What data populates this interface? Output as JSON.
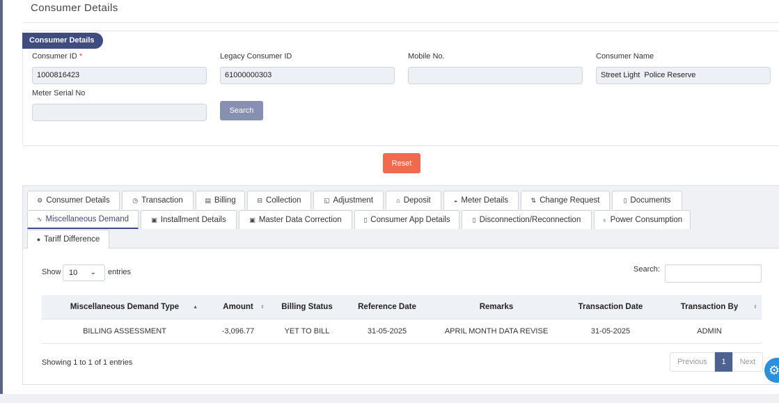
{
  "page": {
    "title": "Consumer Details"
  },
  "card": {
    "badge": "Consumer Details",
    "fields": {
      "consumer_id": {
        "label": "Consumer ID",
        "required_mark": "*",
        "value": "1000816423"
      },
      "legacy_consumer_id": {
        "label": "Legacy Consumer ID",
        "value": "61000000303"
      },
      "mobile_no": {
        "label": "Mobile No.",
        "value": ""
      },
      "consumer_name": {
        "label": "Consumer Name",
        "value": "Street Light  Police Reserve"
      },
      "meter_serial_no": {
        "label": "Meter Serial No",
        "value": ""
      }
    },
    "search_label": "Search"
  },
  "reset_label": "Reset",
  "tabs": [
    {
      "label": "Consumer Details",
      "icon": "gear-icon"
    },
    {
      "label": "Transaction",
      "icon": "clock-icon"
    },
    {
      "label": "Billing",
      "icon": "bill-icon"
    },
    {
      "label": "Collection",
      "icon": "collection-icon"
    },
    {
      "label": "Adjustment",
      "icon": "adjust-icon"
    },
    {
      "label": "Deposit",
      "icon": "bank-icon"
    },
    {
      "label": "Meter Details",
      "icon": "meter-icon"
    },
    {
      "label": "Change Request",
      "icon": "swap-icon"
    },
    {
      "label": "Documents",
      "icon": "document-icon"
    },
    {
      "label": "Miscellaneous Demand",
      "icon": "pulse-icon",
      "active": true
    },
    {
      "label": "Installment Details",
      "icon": "list-icon"
    },
    {
      "label": "Master Data Correction",
      "icon": "list-icon"
    },
    {
      "label": "Consumer App Details",
      "icon": "mobile-icon"
    },
    {
      "label": "Disconnection/Reconnection",
      "icon": "mobile-icon"
    },
    {
      "label": "Power Consumption",
      "icon": "bulb-icon"
    },
    {
      "label": "Tariff Difference",
      "icon": "dot-icon"
    }
  ],
  "table": {
    "show_label": "Show",
    "page_length": "10",
    "entries_label": "entries",
    "search_label": "Search:",
    "columns": [
      "Miscellaneous Demand Type",
      "Amount",
      "Billing Status",
      "Reference Date",
      "Remarks",
      "Transaction Date",
      "Transaction By"
    ],
    "rows": [
      [
        "BILLING ASSESSMENT",
        "-3,096.77",
        "YET TO BILL",
        "31-05-2025",
        "APRIL MONTH DATA REVISE",
        "31-05-2025",
        "ADMIN"
      ]
    ],
    "info": "Showing 1 to 1 of 1 entries",
    "pagination": {
      "previous": "Previous",
      "current": "1",
      "next": "Next"
    }
  },
  "colors": {
    "primary": "#3e4c7f",
    "reset": "#ef6a4e",
    "search_button": "#8790b0",
    "fab": "#2b8fd9"
  }
}
